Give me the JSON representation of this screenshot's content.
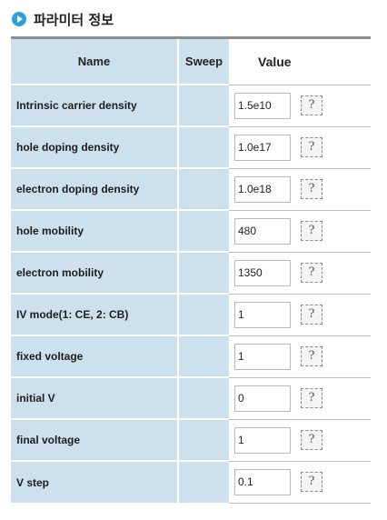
{
  "section": {
    "title": "파라미터 정보",
    "icon": "play-circle-icon",
    "accent_color": "#2ca0d8"
  },
  "table": {
    "headers": {
      "name": "Name",
      "sweep": "Sweep",
      "value": "Value"
    },
    "help_label": "?",
    "rows": [
      {
        "name": "Intrinsic carrier density",
        "value": "1.5e10"
      },
      {
        "name": "hole doping density",
        "value": "1.0e17"
      },
      {
        "name": "electron doping density",
        "value": "1.0e18"
      },
      {
        "name": "hole mobility",
        "value": "480"
      },
      {
        "name": "electron mobility",
        "value": "1350"
      },
      {
        "name": "IV mode(1: CE, 2: CB)",
        "value": "1"
      },
      {
        "name": "fixed voltage",
        "value": "1"
      },
      {
        "name": "initial V",
        "value": "0"
      },
      {
        "name": "final voltage",
        "value": "1"
      },
      {
        "name": "V step",
        "value": "0.1"
      }
    ]
  }
}
